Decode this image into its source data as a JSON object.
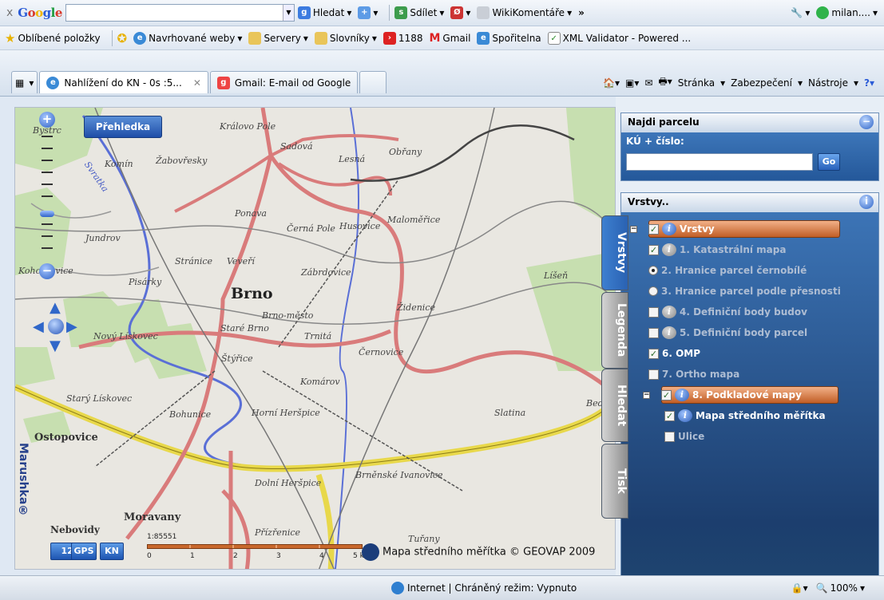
{
  "google_bar": {
    "close": "x",
    "logo": "Google",
    "search_value": "",
    "hledat": "Hledat",
    "sdilet": "Sdílet",
    "wiki": "WikiKomentáře",
    "more": "»",
    "user": "milan...."
  },
  "favorites_bar": {
    "oblibene": "Oblíbené položky",
    "items": [
      "Navrhované weby",
      "Servery",
      "Slovníky",
      "1188",
      "Gmail",
      "Spořitelna",
      "XML Validator - Powered ..."
    ]
  },
  "tabs": [
    {
      "label": "Nahlížení do KN - 0s :5..."
    },
    {
      "label": "Gmail: E-mail od Google"
    }
  ],
  "command_bar": {
    "stranka": "Stránka",
    "zabezpeceni": "Zabezpečení",
    "nastroje": "Nástroje"
  },
  "map": {
    "prehledka": "Přehledka",
    "brand": "Marushka®",
    "buttons": [
      "123",
      "GPS",
      "KN"
    ],
    "scale_ratio": "1:85551",
    "scale_ticks": [
      "0",
      "1",
      "2",
      "3",
      "4",
      "5 km"
    ],
    "copyright": "Mapa středního měřítka © GEOVAP 2009",
    "labels": {
      "bystrc": "Bystrc",
      "kralovo_pole": "Královo Pole",
      "sadova": "Sadová",
      "obrany": "Obřany",
      "lesna": "Lesná",
      "komin": "Komín",
      "zabovresky": "Žabovřesky",
      "svratka": "Svratka",
      "ponava": "Ponava",
      "malomerice": "Maloměřice",
      "cerna_pole": "Černá Pole",
      "husovice": "Husovice",
      "jundrov": "Jundrov",
      "zabrdovice": "Zábrdovice",
      "straznice": "Stránice",
      "veveri": "Veveří",
      "kohoutovice": "Kohoutovice",
      "pisarky": "Pisárky",
      "brno": "Brno",
      "brno_mesto": "Brno-město",
      "zidenice": "Židenice",
      "liseň": "Líšeň",
      "novy_liskovec": "Nový Lískovec",
      "stare_brno": "Staré Brno",
      "trnita": "Trnitá",
      "cernovice": "Černovice",
      "styrice": "Štýřice",
      "komarov": "Komárov",
      "stary_liskovec": "Starý Lískovec",
      "bohunice": "Bohunice",
      "horni_herspice": "Horní Heršpice",
      "slatina": "Slatina",
      "bed": "Bed",
      "ostopovice": "Ostopovice",
      "dolni_herspice": "Dolní Heršpice",
      "brnenske_ivanovice": "Brněnské Ivanovice",
      "moravany": "Moravany",
      "nebovidy": "Nebovidy",
      "prizrenice": "Přízřenice",
      "turany": "Tuřany"
    }
  },
  "sidebar": {
    "najdi_title": "Najdi parcelu",
    "ku_label": "KÚ + číslo:",
    "ku_value": "",
    "go": "Go",
    "vrstvy_title": "Vrstvy..",
    "vtabs": [
      "Vrstvy",
      "Legenda",
      "Hledat",
      "Tisk"
    ],
    "layers": [
      {
        "label": "Vrstvy"
      },
      {
        "label": "1. Katastrální mapa"
      },
      {
        "label": "2. Hranice parcel černobílé"
      },
      {
        "label": "3. Hranice parcel podle přesnosti"
      },
      {
        "label": "4. Definiční body budov"
      },
      {
        "label": "5. Definiční body parcel"
      },
      {
        "label": "6. OMP"
      },
      {
        "label": "7. Ortho mapa"
      },
      {
        "label": "8. Podkladové mapy"
      },
      {
        "label": "Mapa středního měřítka"
      },
      {
        "label": "Ulice"
      }
    ]
  },
  "status_bar": {
    "zone": "Internet | Chráněný režim: Vypnuto",
    "zoom": "100%"
  },
  "colors": {
    "road_major": "#d97b7b",
    "highway": "#e8d84a",
    "water": "#5a6fd6",
    "forest": "#c7dfb0",
    "panel_blue": "#24589a",
    "highlight": "#c15e26"
  }
}
